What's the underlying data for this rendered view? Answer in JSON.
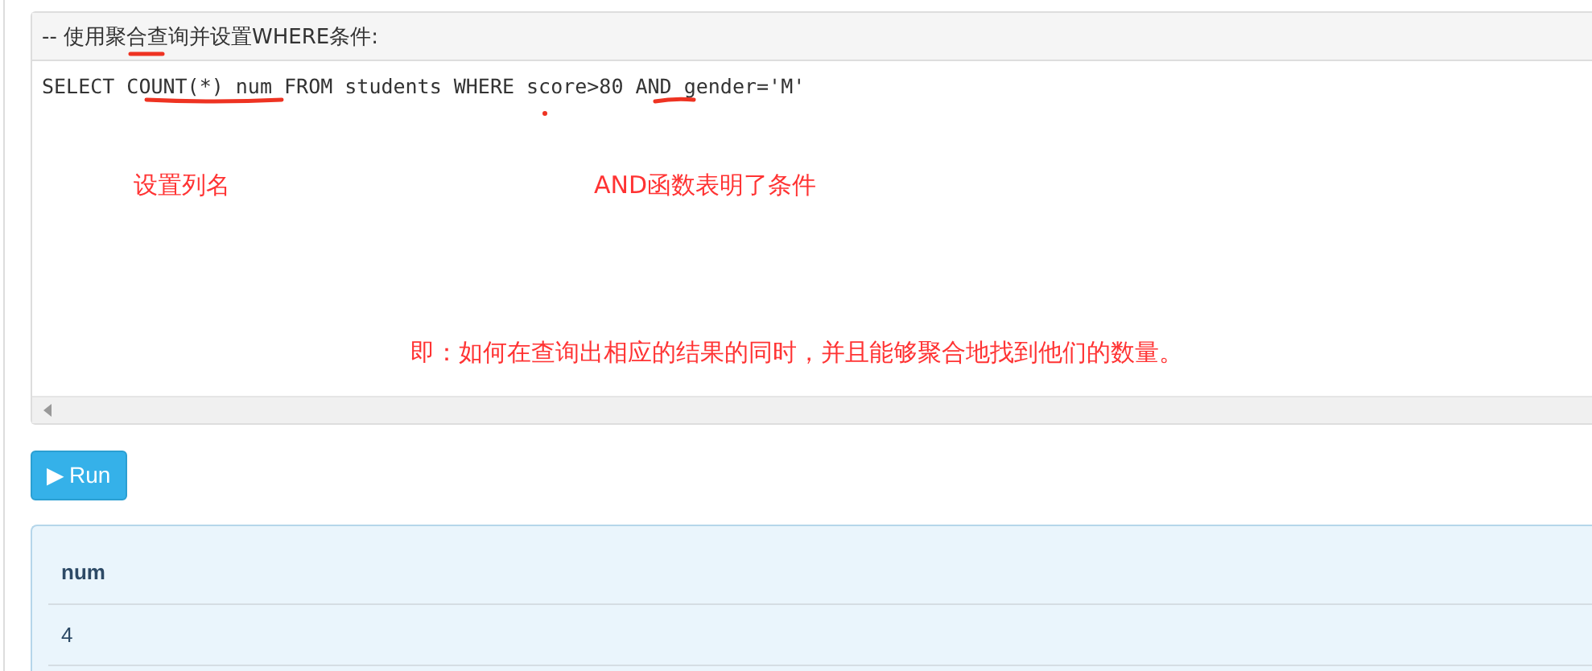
{
  "editor": {
    "comment": "-- 使用聚合查询并设置WHERE条件:",
    "code": "SELECT COUNT(*) num FROM students WHERE score>80 AND gender='M'",
    "annotations": [
      {
        "text": "设置列名"
      },
      {
        "text": "AND函数表明了条件"
      },
      {
        "text": "即：如何在查询出相应的结果的同时，并且能够聚合地找到他们的数量。"
      }
    ]
  },
  "run_button": {
    "icon": "▶",
    "label": "Run"
  },
  "result": {
    "columns": [
      "num"
    ],
    "rows": [
      [
        "4"
      ]
    ]
  }
}
